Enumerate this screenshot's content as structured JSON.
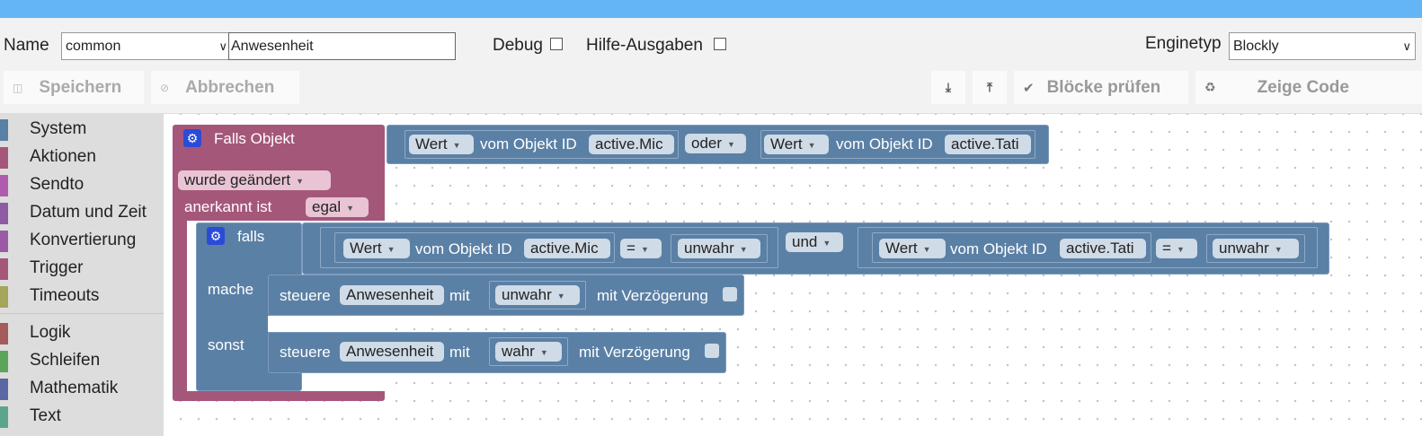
{
  "header": {
    "name_label": "Name",
    "instance_value": "common",
    "script_name": "Anwesenheit",
    "debug_label": "Debug",
    "help_label": "Hilfe-Ausgaben",
    "engine_label": "Enginetyp",
    "engine_value": "Blockly"
  },
  "toolbar": {
    "save": "Speichern",
    "cancel": "Abbrechen",
    "check_blocks": "Blöcke prüfen",
    "show_code": "Zeige Code"
  },
  "sidebar": {
    "items": [
      {
        "label": "System",
        "color": "#5b80a5"
      },
      {
        "label": "Aktionen",
        "color": "#a5577a"
      },
      {
        "label": "Sendto",
        "color": "#b05cae"
      },
      {
        "label": "Datum und Zeit",
        "color": "#8e5ba5"
      },
      {
        "label": "Konvertierung",
        "color": "#9a5ba5"
      },
      {
        "label": "Trigger",
        "color": "#a5577a"
      },
      {
        "label": "Timeouts",
        "color": "#a5a55b"
      },
      {
        "label": "Logik",
        "color": "#a55b5b"
      },
      {
        "label": "Schleifen",
        "color": "#5ba55b"
      },
      {
        "label": "Mathematik",
        "color": "#5b67a5"
      },
      {
        "label": "Text",
        "color": "#5ba58c"
      }
    ]
  },
  "blocks": {
    "trigger": {
      "title": "Falls Objekt",
      "changed": "wurde geändert",
      "ack_label": "anerkannt ist",
      "ack_value": "egal"
    },
    "trigger_cond": {
      "left": {
        "attr": "Wert",
        "of": "vom Objekt ID",
        "id": "active.Mic"
      },
      "op": "oder",
      "right": {
        "attr": "Wert",
        "of": "vom Objekt ID",
        "id": "active.Tati"
      }
    },
    "if_block": {
      "if_label": "falls",
      "do_label": "mache",
      "else_label": "sonst"
    },
    "if_cond": {
      "left": {
        "attr": "Wert",
        "of": "vom Objekt ID",
        "id": "active.Mic",
        "cmp": "=",
        "val": "unwahr"
      },
      "op": "und",
      "right": {
        "attr": "Wert",
        "of": "vom Objekt ID",
        "id": "active.Tati",
        "cmp": "=",
        "val": "unwahr"
      }
    },
    "do_stmt": {
      "control": "steuere",
      "target": "Anwesenheit",
      "with": "mit",
      "value": "unwahr",
      "delay": "mit Verzögerung"
    },
    "else_stmt": {
      "control": "steuere",
      "target": "Anwesenheit",
      "with": "mit",
      "value": "wahr",
      "delay": "mit Verzögerung"
    }
  },
  "colors": {
    "accent": "#64b5f6",
    "event_block": "#a5577a",
    "logic_block": "#5b80a5"
  }
}
